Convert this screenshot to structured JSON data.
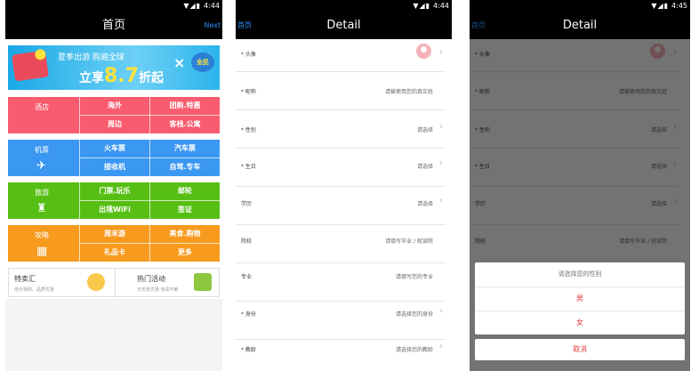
{
  "status": {
    "time1": "4:44",
    "time2": "4:44",
    "time3": "4:45"
  },
  "home": {
    "title": "首页",
    "next": "Next",
    "banner": {
      "line1": "夏季出游 购遍全球",
      "prefix": "立享",
      "big": "8.7",
      "suffix": "折起",
      "times": "×",
      "badge": "全民"
    },
    "sections": [
      {
        "main": "酒店",
        "cells": [
          "海外",
          "团购.特惠",
          "周边",
          "客栈.公寓"
        ]
      },
      {
        "main": "机票",
        "cells": [
          "火车票",
          "汽车票",
          "接收机",
          "自驾.专车"
        ]
      },
      {
        "main": "旅游",
        "cells": [
          "门票.玩乐",
          "邮轮",
          "出境WiFi",
          "签证"
        ]
      },
      {
        "main": "攻略",
        "cells": [
          "周末游",
          "美食.购物",
          "礼品卡",
          "更多"
        ]
      }
    ],
    "promos": [
      {
        "name": "特卖汇",
        "sub": "低价特购、品质优惠"
      },
      {
        "name": "热门活动",
        "sub": "天天有优惠 惊喜不断"
      }
    ]
  },
  "detail": {
    "back": "首页",
    "title": "Detail",
    "rows": [
      {
        "key": "* 头像",
        "value": ""
      },
      {
        "key": "* 昵称",
        "value": "请输使用您的真实姓"
      },
      {
        "key": "* 性别",
        "value": "请选择"
      },
      {
        "key": "* 生日",
        "value": "请选择"
      },
      {
        "key": "学历",
        "value": "请选择"
      },
      {
        "key": "院校",
        "value": "请填写毕业 / 就读院"
      },
      {
        "key": "专业",
        "value": "请填写您的专业"
      },
      {
        "key": "* 身份",
        "value": "请选择您的身份"
      },
      {
        "key": "* 教龄",
        "value": "请选择您的教龄"
      }
    ]
  },
  "picker": {
    "title": "请选择您的性别",
    "options": [
      "男",
      "女"
    ],
    "cancel": "取消"
  }
}
